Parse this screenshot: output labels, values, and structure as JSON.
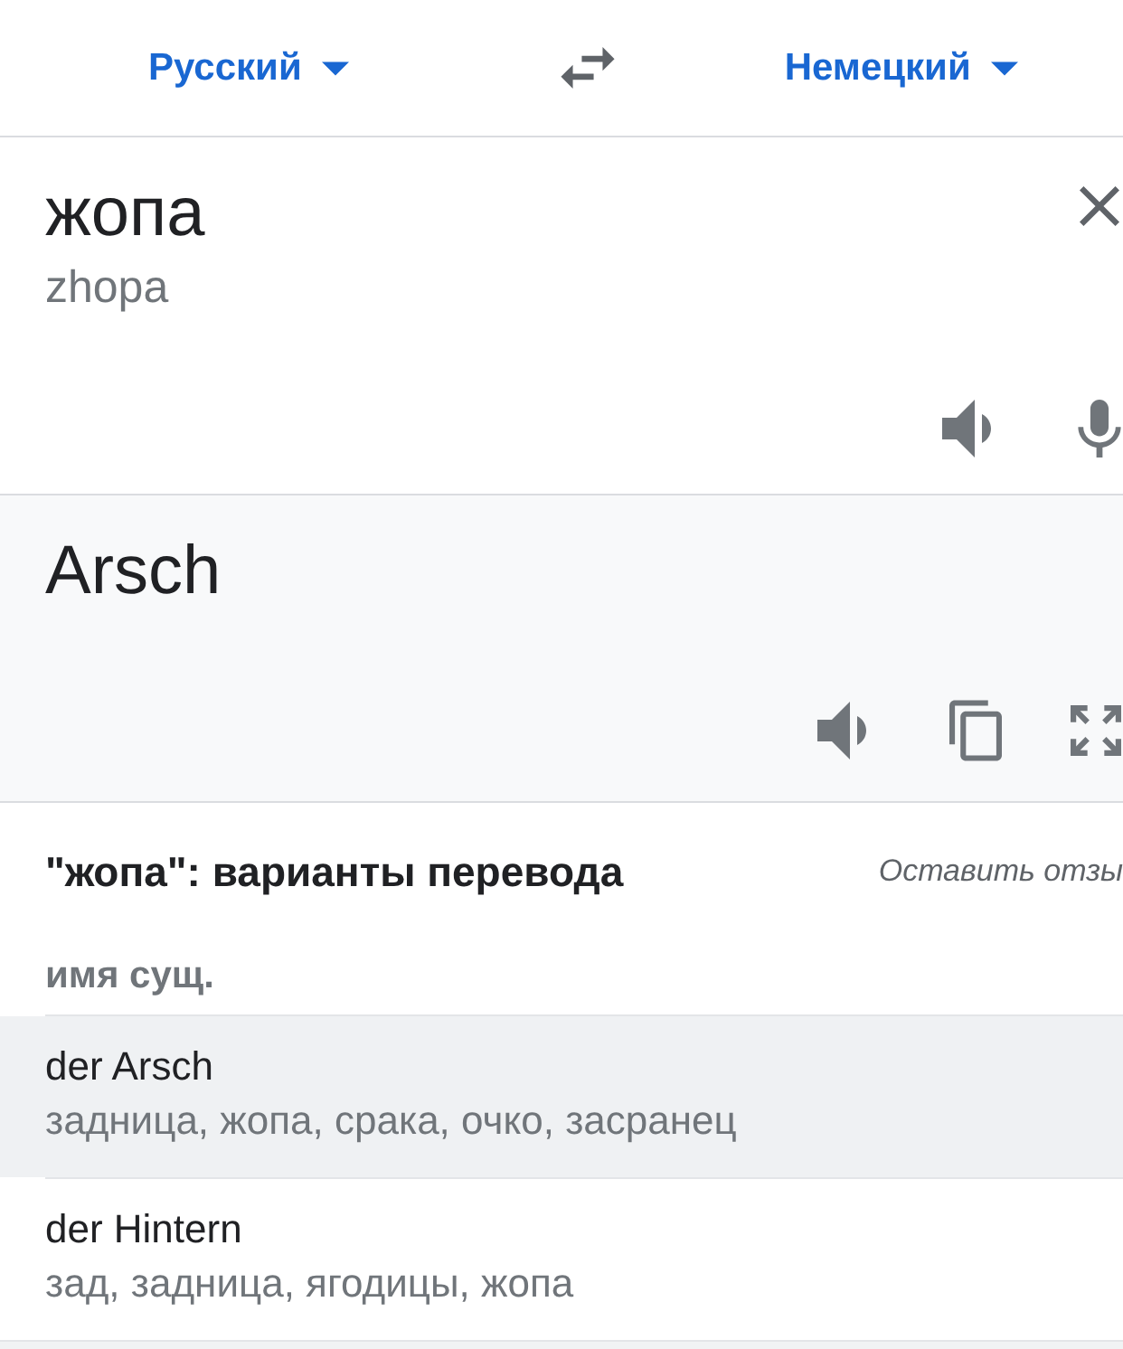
{
  "language_bar": {
    "source_language": "Русский",
    "target_language": "Немецкий"
  },
  "input": {
    "value": "жопа",
    "transliteration": "zhopa"
  },
  "output": {
    "text": "Arsch"
  },
  "translations": {
    "title": "\"жопа\": варианты перевода",
    "feedback_link": "Оставить отзы",
    "part_of_speech": "имя сущ.",
    "entries": [
      {
        "word": "der Arsch",
        "synonyms": "задница, жопа, срака, очко, засранец",
        "selected": true
      },
      {
        "word": "der Hintern",
        "synonyms": "зад, задница, ягодицы, жопа",
        "selected": false
      }
    ]
  }
}
